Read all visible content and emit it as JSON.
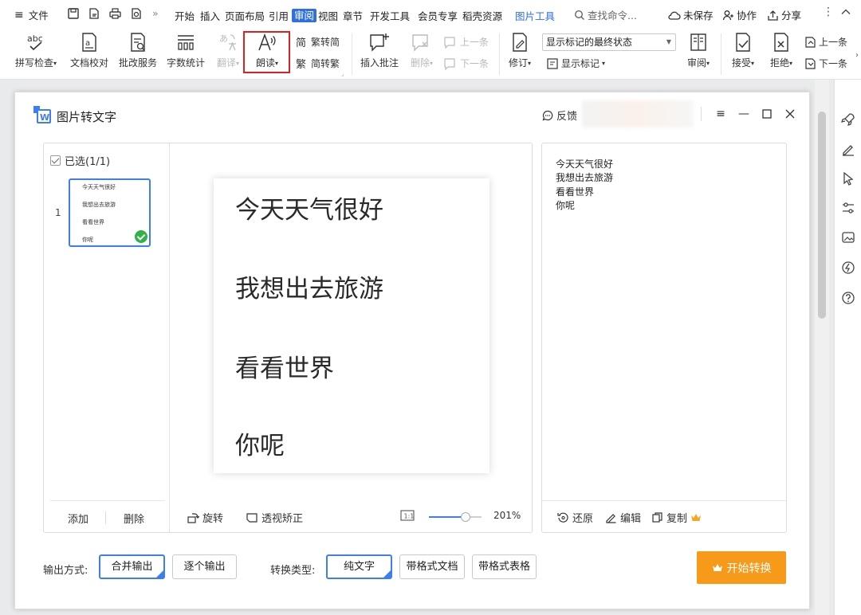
{
  "menu": {
    "file": "文件",
    "tabs": [
      "开始",
      "插入",
      "页面布局",
      "引用",
      "审阅",
      "视图",
      "章节",
      "开发工具",
      "会员专享",
      "稻壳资源"
    ],
    "active_tab": "审阅",
    "context_tab": "图片工具",
    "search_placeholder": "查找命令...",
    "unsaved": "未保存",
    "collaborate": "协作",
    "share": "分享"
  },
  "ribbon": {
    "spell_check": "拼写检查",
    "doc_proof": "文档校对",
    "review_service": "批改服务",
    "word_count": "字数统计",
    "translate": "翻译",
    "read_aloud": "朗读",
    "trad_to_simp": "繁转简",
    "simp_to_trad": "简转繁",
    "insert_comment": "插入批注",
    "delete": "删除",
    "prev": "上一条",
    "next": "下一条",
    "track_changes": "修订",
    "markup_state": "显示标记的最终状态",
    "show_markup": "显示标记",
    "review_pane": "审阅",
    "accept": "接受",
    "reject": "拒绝",
    "prev_change": "上一条",
    "next_change": "下一条"
  },
  "dialog": {
    "title": "图片转文字",
    "feedback": "反馈",
    "selected": "已选(1/1)",
    "thumb_index": "1",
    "add": "添加",
    "delete": "删除",
    "rotate": "旋转",
    "perspective": "透视矫正",
    "fit_icon": "1:1",
    "zoom": "201%",
    "zoom_level": 0.7,
    "image_lines": [
      "今天天气很好",
      "我想出去旅游",
      "看看世界",
      "你呢"
    ],
    "ocr_lines": [
      "今天天气很好",
      "我想出去旅游",
      "看看世界",
      "你呢"
    ],
    "restore": "还原",
    "edit": "编辑",
    "copy": "复制",
    "output_label": "输出方式:",
    "output_merge": "合并输出",
    "output_each": "逐个输出",
    "convert_label": "转换类型:",
    "type_plain": "纯文字",
    "type_format_doc": "带格式文档",
    "type_format_table": "带格式表格",
    "start": "开始转换"
  },
  "colors": {
    "accent": "#2f6fe4",
    "start_button": "#f79a1a",
    "highlight_box": "#e02020",
    "check_green": "#2fb344"
  }
}
